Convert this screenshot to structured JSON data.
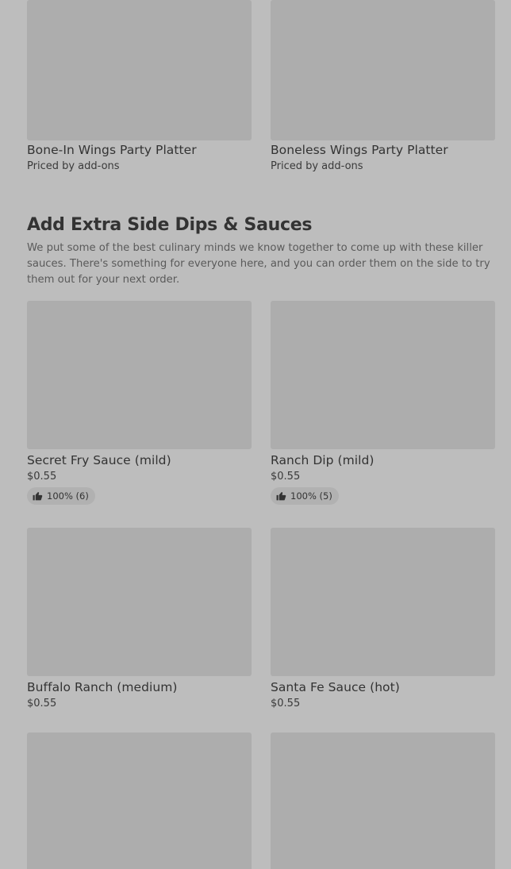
{
  "top_items": [
    {
      "name": "Bone-In Wings Party Platter",
      "price": "Priced by add-ons"
    },
    {
      "name": "Boneless Wings Party Platter",
      "price": "Priced by add-ons"
    }
  ],
  "section": {
    "title": "Add Extra Side Dips & Sauces",
    "description": "We put some of the best culinary minds we know together to come up with these killer sauces. There's something for everyone here, and you can order them on the side to try them out for your next order."
  },
  "sauces": [
    {
      "name": "Secret Fry Sauce (mild)",
      "price": "$0.55",
      "rating": "100% (6)"
    },
    {
      "name": "Ranch Dip (mild)",
      "price": "$0.55",
      "rating": "100% (5)"
    },
    {
      "name": "Buffalo Ranch (medium)",
      "price": "$0.55"
    },
    {
      "name": "Santa Fe Sauce (hot)",
      "price": "$0.55"
    }
  ],
  "icons": {
    "rating": "thumbs-up-icon"
  },
  "colors": {
    "page_background": "#bdbdbd",
    "placeholder_image": "#adadad",
    "badge_background": "#b1b1b1"
  }
}
